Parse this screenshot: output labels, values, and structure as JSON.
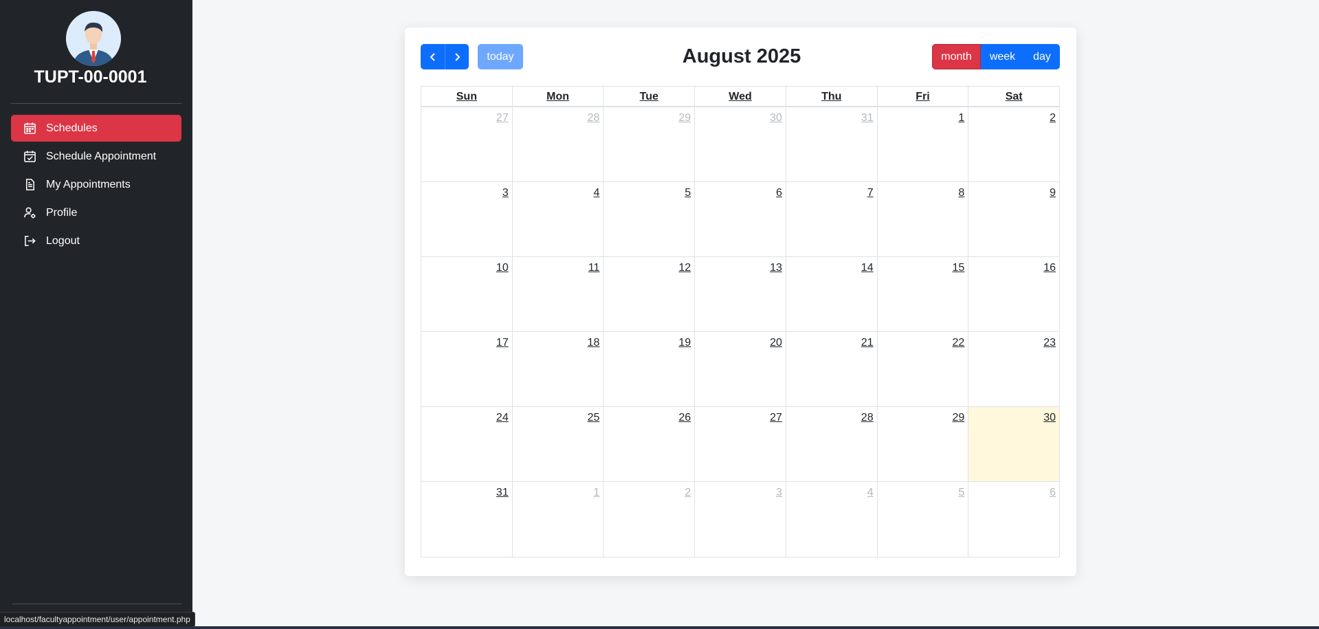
{
  "user": {
    "id": "TUPT-00-0001"
  },
  "sidebar": {
    "items": [
      {
        "label": "Schedules",
        "icon": "calendar-icon",
        "active": true
      },
      {
        "label": "Schedule Appointment",
        "icon": "calendar-check-icon",
        "active": false
      },
      {
        "label": "My Appointments",
        "icon": "document-icon",
        "active": false
      },
      {
        "label": "Profile",
        "icon": "user-gear-icon",
        "active": false
      },
      {
        "label": "Logout",
        "icon": "logout-icon",
        "active": false
      }
    ]
  },
  "status_bar": {
    "url": "localhost/facultyappointment/user/appointment.php"
  },
  "calendar": {
    "title": "August 2025",
    "today_label": "today",
    "views": {
      "month": "month",
      "week": "week",
      "day": "day"
    },
    "active_view": "month",
    "weekdays": [
      "Sun",
      "Mon",
      "Tue",
      "Wed",
      "Thu",
      "Fri",
      "Sat"
    ],
    "weeks": [
      [
        {
          "d": "27",
          "other": true
        },
        {
          "d": "28",
          "other": true
        },
        {
          "d": "29",
          "other": true
        },
        {
          "d": "30",
          "other": true
        },
        {
          "d": "31",
          "other": true
        },
        {
          "d": "1"
        },
        {
          "d": "2"
        }
      ],
      [
        {
          "d": "3"
        },
        {
          "d": "4"
        },
        {
          "d": "5"
        },
        {
          "d": "6"
        },
        {
          "d": "7"
        },
        {
          "d": "8"
        },
        {
          "d": "9"
        }
      ],
      [
        {
          "d": "10"
        },
        {
          "d": "11"
        },
        {
          "d": "12"
        },
        {
          "d": "13"
        },
        {
          "d": "14"
        },
        {
          "d": "15"
        },
        {
          "d": "16"
        }
      ],
      [
        {
          "d": "17"
        },
        {
          "d": "18"
        },
        {
          "d": "19"
        },
        {
          "d": "20"
        },
        {
          "d": "21"
        },
        {
          "d": "22"
        },
        {
          "d": "23"
        }
      ],
      [
        {
          "d": "24"
        },
        {
          "d": "25"
        },
        {
          "d": "26"
        },
        {
          "d": "27"
        },
        {
          "d": "28"
        },
        {
          "d": "29"
        },
        {
          "d": "30",
          "today": true
        }
      ],
      [
        {
          "d": "31"
        },
        {
          "d": "1",
          "other": true
        },
        {
          "d": "2",
          "other": true
        },
        {
          "d": "3",
          "other": true
        },
        {
          "d": "4",
          "other": true
        },
        {
          "d": "5",
          "other": true
        },
        {
          "d": "6",
          "other": true
        }
      ]
    ]
  },
  "colors": {
    "sidebar_bg": "#212529",
    "active": "#dc3545",
    "primary": "#0d6efd",
    "today_bg": "#fff8dc"
  }
}
